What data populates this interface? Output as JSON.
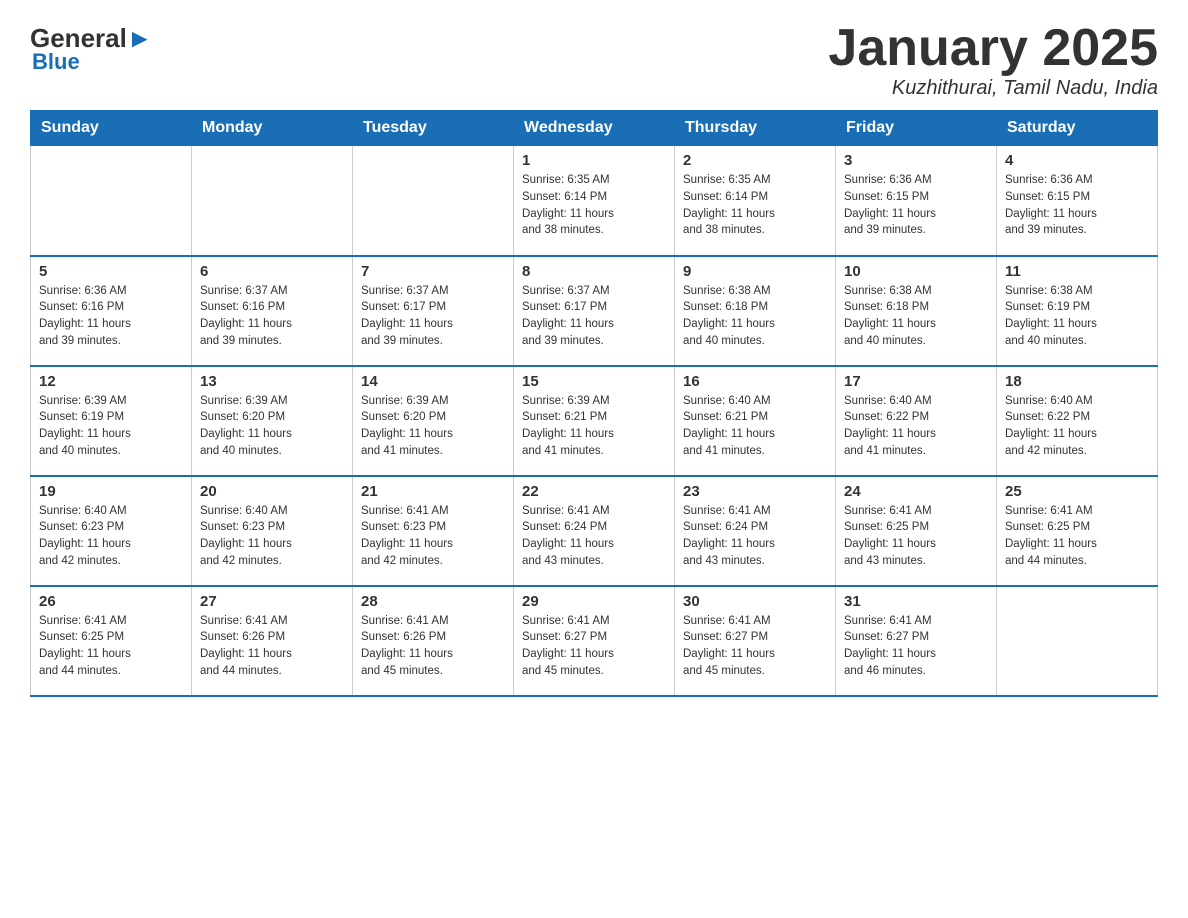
{
  "header": {
    "logo_general": "General",
    "logo_blue": "Blue",
    "month_title": "January 2025",
    "location": "Kuzhithurai, Tamil Nadu, India"
  },
  "weekdays": [
    "Sunday",
    "Monday",
    "Tuesday",
    "Wednesday",
    "Thursday",
    "Friday",
    "Saturday"
  ],
  "weeks": [
    [
      {
        "day": "",
        "info": ""
      },
      {
        "day": "",
        "info": ""
      },
      {
        "day": "",
        "info": ""
      },
      {
        "day": "1",
        "info": "Sunrise: 6:35 AM\nSunset: 6:14 PM\nDaylight: 11 hours\nand 38 minutes."
      },
      {
        "day": "2",
        "info": "Sunrise: 6:35 AM\nSunset: 6:14 PM\nDaylight: 11 hours\nand 38 minutes."
      },
      {
        "day": "3",
        "info": "Sunrise: 6:36 AM\nSunset: 6:15 PM\nDaylight: 11 hours\nand 39 minutes."
      },
      {
        "day": "4",
        "info": "Sunrise: 6:36 AM\nSunset: 6:15 PM\nDaylight: 11 hours\nand 39 minutes."
      }
    ],
    [
      {
        "day": "5",
        "info": "Sunrise: 6:36 AM\nSunset: 6:16 PM\nDaylight: 11 hours\nand 39 minutes."
      },
      {
        "day": "6",
        "info": "Sunrise: 6:37 AM\nSunset: 6:16 PM\nDaylight: 11 hours\nand 39 minutes."
      },
      {
        "day": "7",
        "info": "Sunrise: 6:37 AM\nSunset: 6:17 PM\nDaylight: 11 hours\nand 39 minutes."
      },
      {
        "day": "8",
        "info": "Sunrise: 6:37 AM\nSunset: 6:17 PM\nDaylight: 11 hours\nand 39 minutes."
      },
      {
        "day": "9",
        "info": "Sunrise: 6:38 AM\nSunset: 6:18 PM\nDaylight: 11 hours\nand 40 minutes."
      },
      {
        "day": "10",
        "info": "Sunrise: 6:38 AM\nSunset: 6:18 PM\nDaylight: 11 hours\nand 40 minutes."
      },
      {
        "day": "11",
        "info": "Sunrise: 6:38 AM\nSunset: 6:19 PM\nDaylight: 11 hours\nand 40 minutes."
      }
    ],
    [
      {
        "day": "12",
        "info": "Sunrise: 6:39 AM\nSunset: 6:19 PM\nDaylight: 11 hours\nand 40 minutes."
      },
      {
        "day": "13",
        "info": "Sunrise: 6:39 AM\nSunset: 6:20 PM\nDaylight: 11 hours\nand 40 minutes."
      },
      {
        "day": "14",
        "info": "Sunrise: 6:39 AM\nSunset: 6:20 PM\nDaylight: 11 hours\nand 41 minutes."
      },
      {
        "day": "15",
        "info": "Sunrise: 6:39 AM\nSunset: 6:21 PM\nDaylight: 11 hours\nand 41 minutes."
      },
      {
        "day": "16",
        "info": "Sunrise: 6:40 AM\nSunset: 6:21 PM\nDaylight: 11 hours\nand 41 minutes."
      },
      {
        "day": "17",
        "info": "Sunrise: 6:40 AM\nSunset: 6:22 PM\nDaylight: 11 hours\nand 41 minutes."
      },
      {
        "day": "18",
        "info": "Sunrise: 6:40 AM\nSunset: 6:22 PM\nDaylight: 11 hours\nand 42 minutes."
      }
    ],
    [
      {
        "day": "19",
        "info": "Sunrise: 6:40 AM\nSunset: 6:23 PM\nDaylight: 11 hours\nand 42 minutes."
      },
      {
        "day": "20",
        "info": "Sunrise: 6:40 AM\nSunset: 6:23 PM\nDaylight: 11 hours\nand 42 minutes."
      },
      {
        "day": "21",
        "info": "Sunrise: 6:41 AM\nSunset: 6:23 PM\nDaylight: 11 hours\nand 42 minutes."
      },
      {
        "day": "22",
        "info": "Sunrise: 6:41 AM\nSunset: 6:24 PM\nDaylight: 11 hours\nand 43 minutes."
      },
      {
        "day": "23",
        "info": "Sunrise: 6:41 AM\nSunset: 6:24 PM\nDaylight: 11 hours\nand 43 minutes."
      },
      {
        "day": "24",
        "info": "Sunrise: 6:41 AM\nSunset: 6:25 PM\nDaylight: 11 hours\nand 43 minutes."
      },
      {
        "day": "25",
        "info": "Sunrise: 6:41 AM\nSunset: 6:25 PM\nDaylight: 11 hours\nand 44 minutes."
      }
    ],
    [
      {
        "day": "26",
        "info": "Sunrise: 6:41 AM\nSunset: 6:25 PM\nDaylight: 11 hours\nand 44 minutes."
      },
      {
        "day": "27",
        "info": "Sunrise: 6:41 AM\nSunset: 6:26 PM\nDaylight: 11 hours\nand 44 minutes."
      },
      {
        "day": "28",
        "info": "Sunrise: 6:41 AM\nSunset: 6:26 PM\nDaylight: 11 hours\nand 45 minutes."
      },
      {
        "day": "29",
        "info": "Sunrise: 6:41 AM\nSunset: 6:27 PM\nDaylight: 11 hours\nand 45 minutes."
      },
      {
        "day": "30",
        "info": "Sunrise: 6:41 AM\nSunset: 6:27 PM\nDaylight: 11 hours\nand 45 minutes."
      },
      {
        "day": "31",
        "info": "Sunrise: 6:41 AM\nSunset: 6:27 PM\nDaylight: 11 hours\nand 46 minutes."
      },
      {
        "day": "",
        "info": ""
      }
    ]
  ]
}
